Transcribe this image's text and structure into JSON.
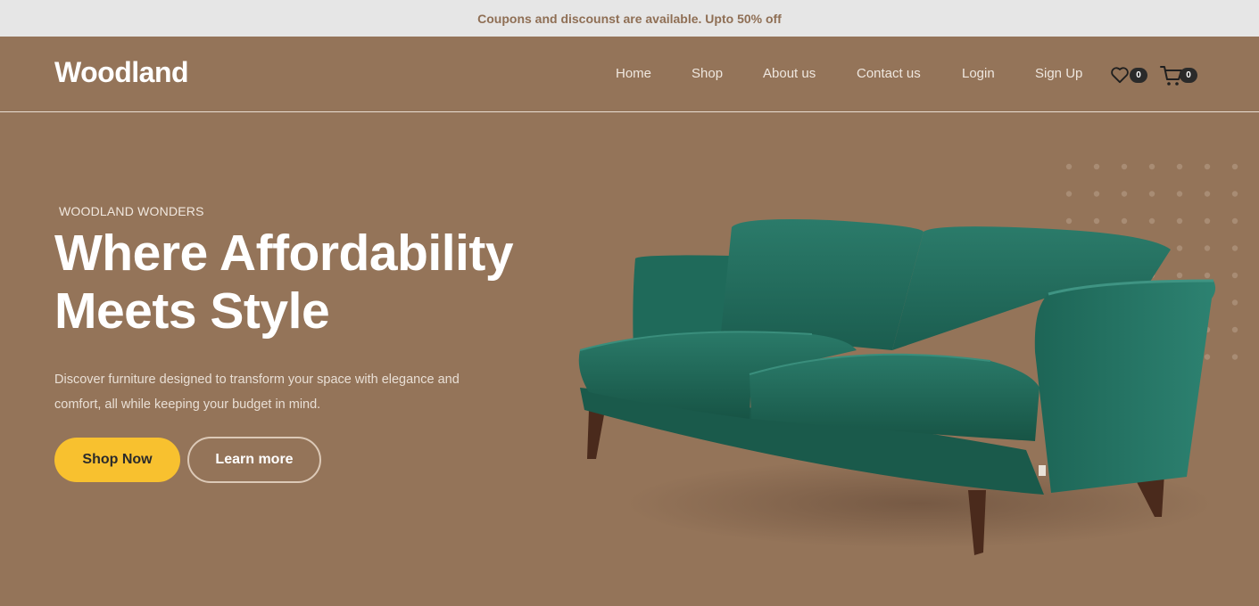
{
  "announcement": "Coupons and discounst are available. Upto 50% off",
  "brand": {
    "name": "Woodland"
  },
  "nav": {
    "items": [
      {
        "label": "Home"
      },
      {
        "label": "Shop"
      },
      {
        "label": "About us"
      },
      {
        "label": "Contact us"
      },
      {
        "label": "Login"
      },
      {
        "label": "Sign Up"
      }
    ],
    "wishlist": {
      "icon": "heart-icon",
      "count": "0"
    },
    "cart": {
      "icon": "cart-icon",
      "count": "0"
    }
  },
  "hero": {
    "eyebrow": "WOODLAND WONDERS",
    "headline_line1": "Where Affordability",
    "headline_line2": "Meets Style",
    "description": "Discover furniture designed to transform your space with elegance and comfort, all while keeping your budget in mind.",
    "primary_button": "Shop Now",
    "secondary_button": "Learn more",
    "image": "green-velvet-sofa"
  },
  "colors": {
    "background": "#947459",
    "topbar": "#e6e6e6",
    "accent": "#f8c12f",
    "sofa": "#1f6b5c"
  }
}
